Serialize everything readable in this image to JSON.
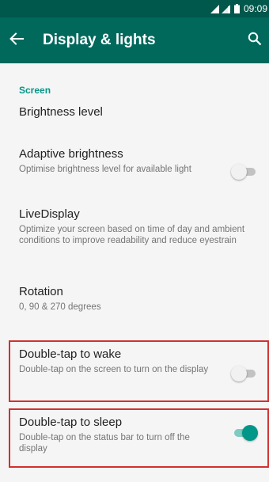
{
  "status_bar": {
    "time": "09:09"
  },
  "app_bar": {
    "title": "Display & lights",
    "back_icon": "arrow-back-icon",
    "search_icon": "search-icon"
  },
  "section": {
    "header": "Screen"
  },
  "prefs": {
    "brightness": {
      "title": "Brightness level"
    },
    "adaptive": {
      "title": "Adaptive brightness",
      "summary": "Optimise brightness level for available light",
      "enabled": false
    },
    "livedisplay": {
      "title": "LiveDisplay",
      "summary": "Optimize your screen based on time of day and ambient conditions to improve readability and reduce eyestrain"
    },
    "rotation": {
      "title": "Rotation",
      "summary": "0, 90 & 270 degrees"
    },
    "double_tap_wake": {
      "title": "Double-tap to wake",
      "summary": "Double-tap on the screen to turn on the display",
      "enabled": false
    },
    "double_tap_sleep": {
      "title": "Double-tap to sleep",
      "summary": "Double-tap on the status bar to turn off the display",
      "enabled": true
    }
  },
  "colors": {
    "status_bar": "#00574b",
    "app_bar": "#00695c",
    "accent": "#009688",
    "highlight_border": "#d32f2f"
  }
}
